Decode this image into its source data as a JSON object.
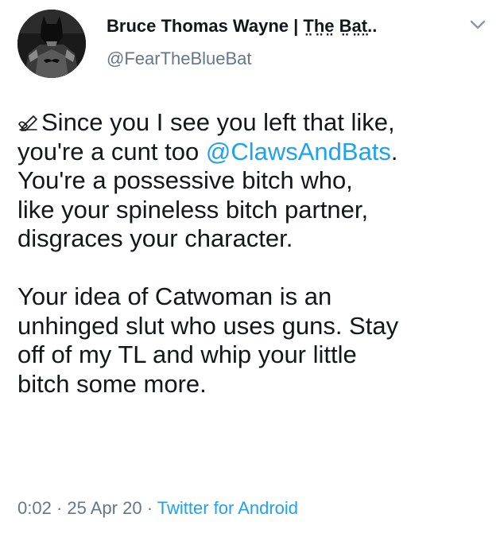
{
  "author": {
    "display_name": "Bruce Thomas Wayne | T̤h̤e̤ B̤a̤t̤..",
    "handle": "@FearTheBlueBat",
    "avatar": "batman-avatar-icon"
  },
  "menu": {
    "icon": "chevron-down-icon"
  },
  "tweet": {
    "icon": "writing-hand-icon",
    "line1": "Since you I see you left that like,",
    "line2_before": "you're a cunt too ",
    "mention": "@ClawsAndBats",
    "line2_after": ".",
    "line3": "You're a possessive bitch who,",
    "line4": "like your spineless bitch partner,",
    "line5": "disgraces your character.",
    "line6": "Your idea of Catwoman is an",
    "line7": "unhinged slut who uses guns. Stay",
    "line8": "off of my TL and whip your little",
    "line9": "bitch some more."
  },
  "meta": {
    "time": "0:02",
    "sep1": " · ",
    "date": "25 Apr 20",
    "sep2": " · ",
    "source": "Twitter for Android"
  },
  "colors": {
    "link": "#1da1f2",
    "secondary": "#657786",
    "text": "#14171a"
  }
}
